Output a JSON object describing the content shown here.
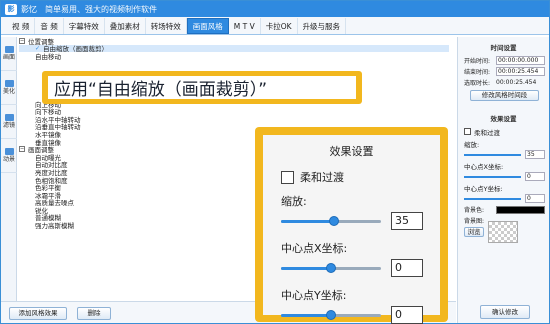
{
  "app": {
    "name": "影忆",
    "subtitle": "简单易用、强大的视频制作软件",
    "logo": "影"
  },
  "menu": [
    "视 频",
    "音 频",
    "字幕特效",
    "叠加素材",
    "转场特效",
    "画面风格",
    "M T V",
    "卡拉OK",
    "升级与服务"
  ],
  "menu_active": 5,
  "vtabs": [
    "画面",
    "美化",
    "滤镜",
    "动景"
  ],
  "tree": {
    "group1": "位置调整",
    "group1_children": [
      "自由缩放（画面裁剪）",
      "自由移动"
    ],
    "group1_more": [
      "向上移动",
      "向下移动",
      "沿水平中轴转动",
      "沿垂直中轴转动",
      "水平镜像",
      "垂直镜像"
    ],
    "group2": "画面调整",
    "group2_children": [
      "自动曝光",
      "自动对比度",
      "亮度对比度",
      "色相饱和度",
      "色彩平衡",
      "冰霜平滑",
      "高质量去噪点",
      "锐化",
      "普通模糊",
      "强力高斯模糊"
    ]
  },
  "callout": {
    "text": "应用“自由缩放（画面裁剪）”"
  },
  "zoom": {
    "title": "效果设置",
    "soft_label": "柔和过渡",
    "scale_label": "缩放:",
    "scale_value": "35",
    "scale_level": 0.53,
    "cx_label": "中心点X坐标:",
    "cx_value": "0",
    "cx_level": 0.5,
    "cy_label": "中心点Y坐标:",
    "cy_value": "0",
    "cy_level": 0.5
  },
  "right": {
    "time_title": "时间设置",
    "start_label": "开始时间:",
    "start_value": "00:00:00.000",
    "end_label": "结束时间:",
    "end_value": "00:00:25.454",
    "dur_label": "选取时长:",
    "dur_value": "00:00:25.454",
    "modify_time_btn": "修改风格时间段",
    "effect_title": "效果设置",
    "soft_label": "柔和过渡",
    "scale_label": "缩放:",
    "scale_value": "35",
    "cx_label": "中心点X坐标:",
    "cx_value": "0",
    "cy_label": "中心点Y坐标:",
    "cy_value": "0",
    "bgcolor_label": "背景色:",
    "bgimage_label": "背景图:",
    "browse_btn": "浏览",
    "confirm_btn": "确认修改"
  },
  "bottom": {
    "add_btn": "添加风格效果",
    "delete_btn": "删除"
  }
}
